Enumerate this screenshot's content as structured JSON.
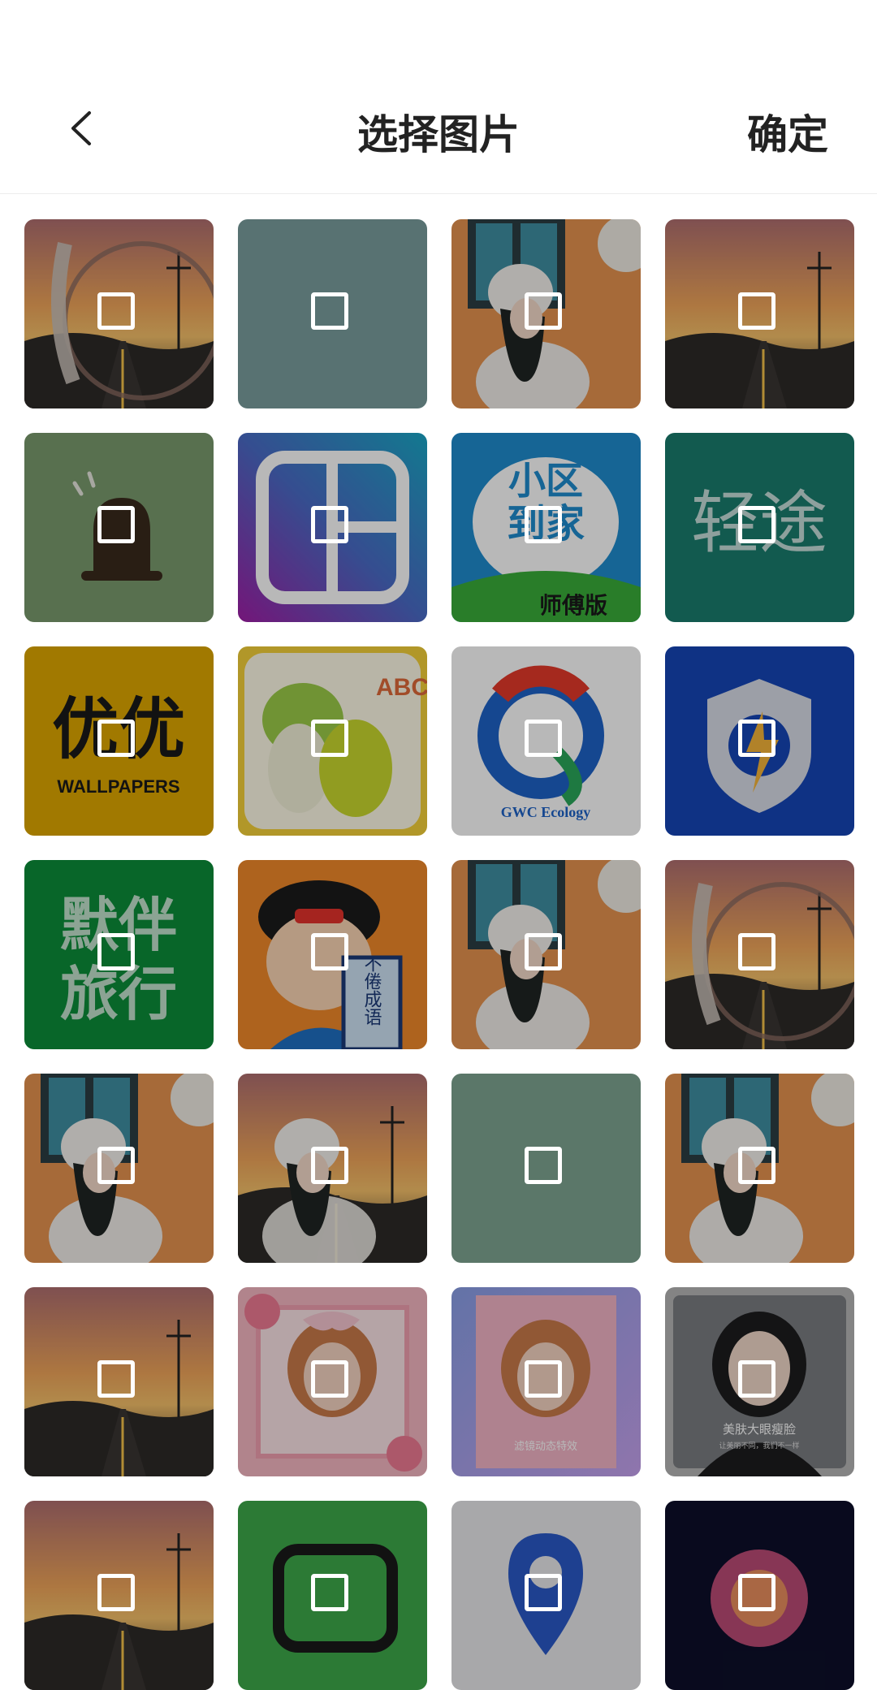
{
  "header": {
    "title": "选择图片",
    "confirm_label": "确定",
    "back_icon": "chevron-left-icon"
  },
  "grid": {
    "tiles": [
      {
        "kind": "sunset-road-lens"
      },
      {
        "kind": "solid-slate",
        "color": "#7a9f9f"
      },
      {
        "kind": "girl-room"
      },
      {
        "kind": "sunset-road"
      },
      {
        "kind": "green-alarm",
        "color": "#7b9b6e"
      },
      {
        "kind": "gradient-frame"
      },
      {
        "kind": "app-xiaoqu",
        "text_top": "小区",
        "text_mid": "到家",
        "text_bottom": "师傅版"
      },
      {
        "kind": "app-qingtu",
        "color": "#1a7d6e",
        "text": "轻途"
      },
      {
        "kind": "app-youyou",
        "color": "#e0a800",
        "text": "优优",
        "subtext": "WALLPAPERS"
      },
      {
        "kind": "app-veggies",
        "text": "ABC"
      },
      {
        "kind": "app-gwc",
        "text": "GWC Ecology"
      },
      {
        "kind": "app-shield"
      },
      {
        "kind": "app-moban",
        "color": "#0c8e3a",
        "text_line1": "默伴",
        "text_line2": "旅行"
      },
      {
        "kind": "app-idiom",
        "text": "不倦成语"
      },
      {
        "kind": "girl-room"
      },
      {
        "kind": "sunset-road-lens"
      },
      {
        "kind": "girl-room"
      },
      {
        "kind": "girl-sunset"
      },
      {
        "kind": "solid-green",
        "color": "#7ea692"
      },
      {
        "kind": "girl-room"
      },
      {
        "kind": "sunset-road"
      },
      {
        "kind": "girl-pink-roses"
      },
      {
        "kind": "girl-pink-frame",
        "caption": "滤镜动态特效"
      },
      {
        "kind": "girl-portrait",
        "caption": "美肤大眼瘦脸",
        "subcaption": "让美丽不同，我们不一样"
      },
      {
        "kind": "sunset-road"
      },
      {
        "kind": "app-green-bag",
        "color": "#3daa4a"
      },
      {
        "kind": "app-blue-pin"
      },
      {
        "kind": "app-dark-orb"
      }
    ]
  }
}
